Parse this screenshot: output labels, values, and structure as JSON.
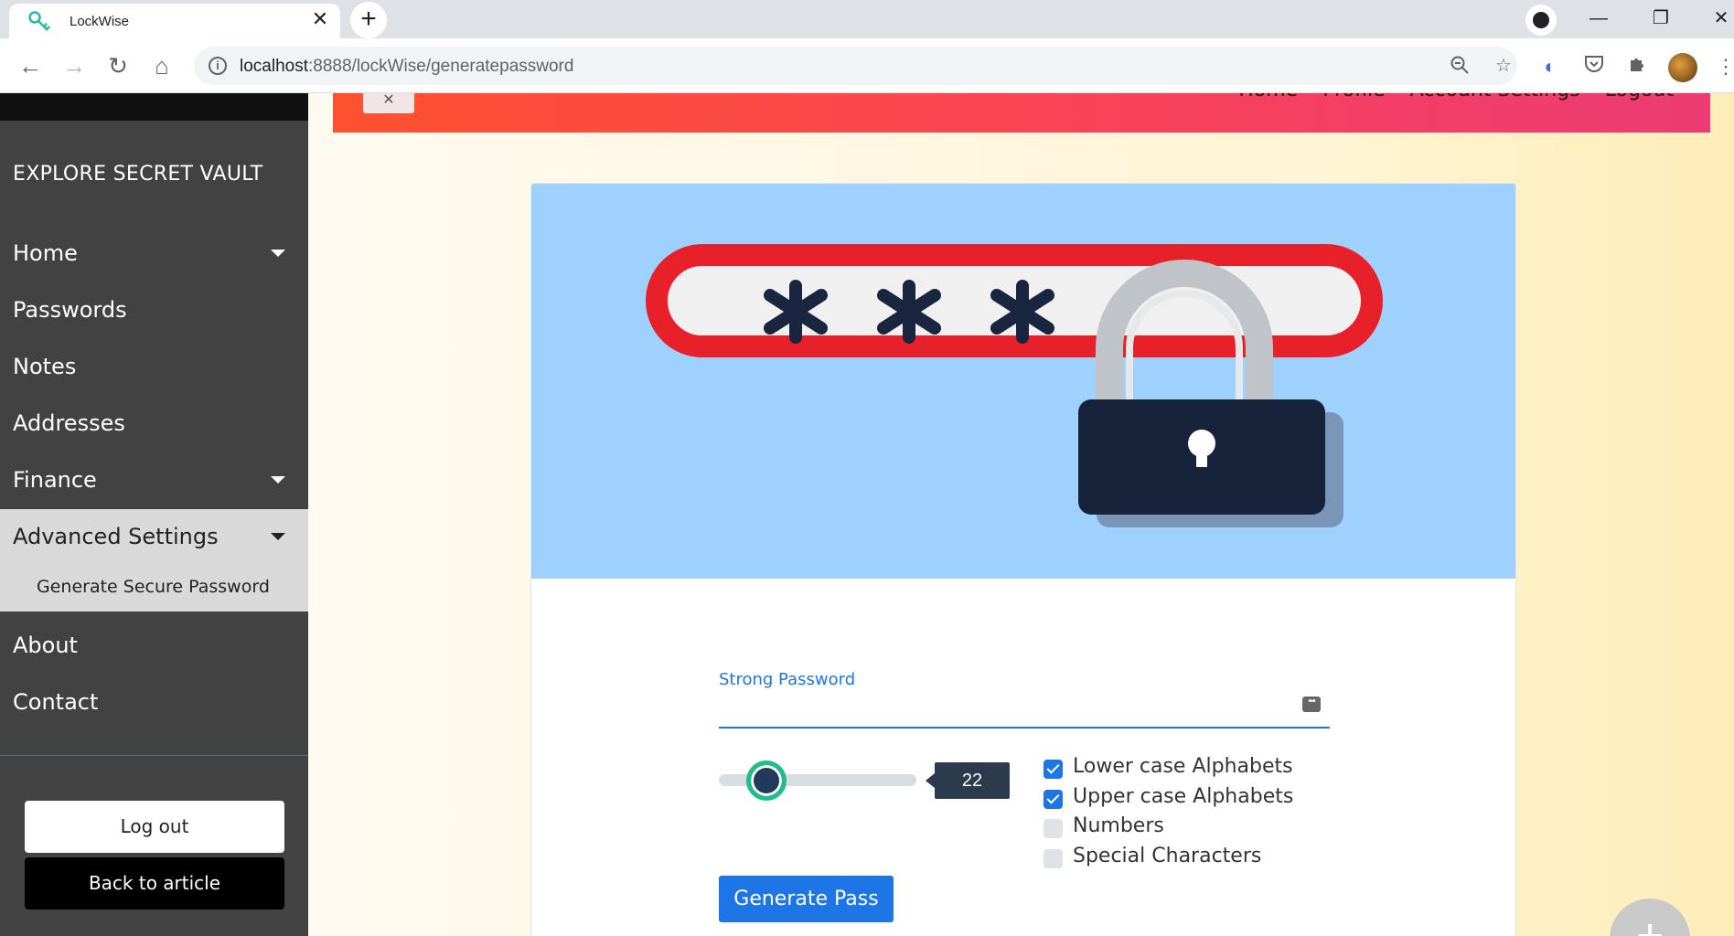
{
  "browser": {
    "tab_title": "LockWise",
    "tab_close": "✕",
    "new_tab": "+",
    "url_host": "localhost",
    "url_rest": ":8888/lockWise/generatepassword",
    "window_controls": {
      "minimize": "—",
      "restore": "❐",
      "close": "✕"
    },
    "nav": {
      "back": "←",
      "forward": "→",
      "reload": "↻",
      "home": "⌂"
    },
    "icons": [
      "zoom-icon",
      "bookmark-star-icon",
      "extension-icon",
      "pocket-icon",
      "puzzle-icon",
      "profile-avatar"
    ]
  },
  "sidebar": {
    "brand": "EXPLORE SECRET VAULT",
    "items": [
      {
        "label": "Home",
        "has_caret": true
      },
      {
        "label": "Passwords",
        "has_caret": false
      },
      {
        "label": "Notes",
        "has_caret": false
      },
      {
        "label": "Addresses",
        "has_caret": false
      },
      {
        "label": "Finance",
        "has_caret": true
      },
      {
        "label": "Advanced Settings",
        "has_caret": true,
        "active": true
      },
      {
        "label": "About",
        "has_caret": false
      },
      {
        "label": "Contact",
        "has_caret": false
      }
    ],
    "submenu_item": "Generate Secure Password",
    "logout_label": "Log out",
    "back_label": "Back to article"
  },
  "topnav": {
    "toggle": "✕",
    "links": [
      "Home",
      "Profile",
      "Account Settings",
      "Logout"
    ]
  },
  "form": {
    "field_label": "Strong Password",
    "field_value": "",
    "length_value": "22",
    "length_fraction": 0.22,
    "options": [
      {
        "label": "Lower case Alphabets",
        "checked": true
      },
      {
        "label": "Upper case Alphabets",
        "checked": true
      },
      {
        "label": "Numbers",
        "checked": false
      },
      {
        "label": "Special Characters",
        "checked": false
      }
    ],
    "generate_label": "Generate Pass"
  },
  "fab": {
    "label": "+"
  },
  "colors": {
    "accent": "#1e76e6",
    "sidebar_bg": "#424242",
    "topnav_gradient_start": "#ff512f",
    "topnav_gradient_end": "#ec3b74",
    "hero_bg": "#9fd1ff",
    "slider_thumb_ring": "#1fbf8a"
  }
}
